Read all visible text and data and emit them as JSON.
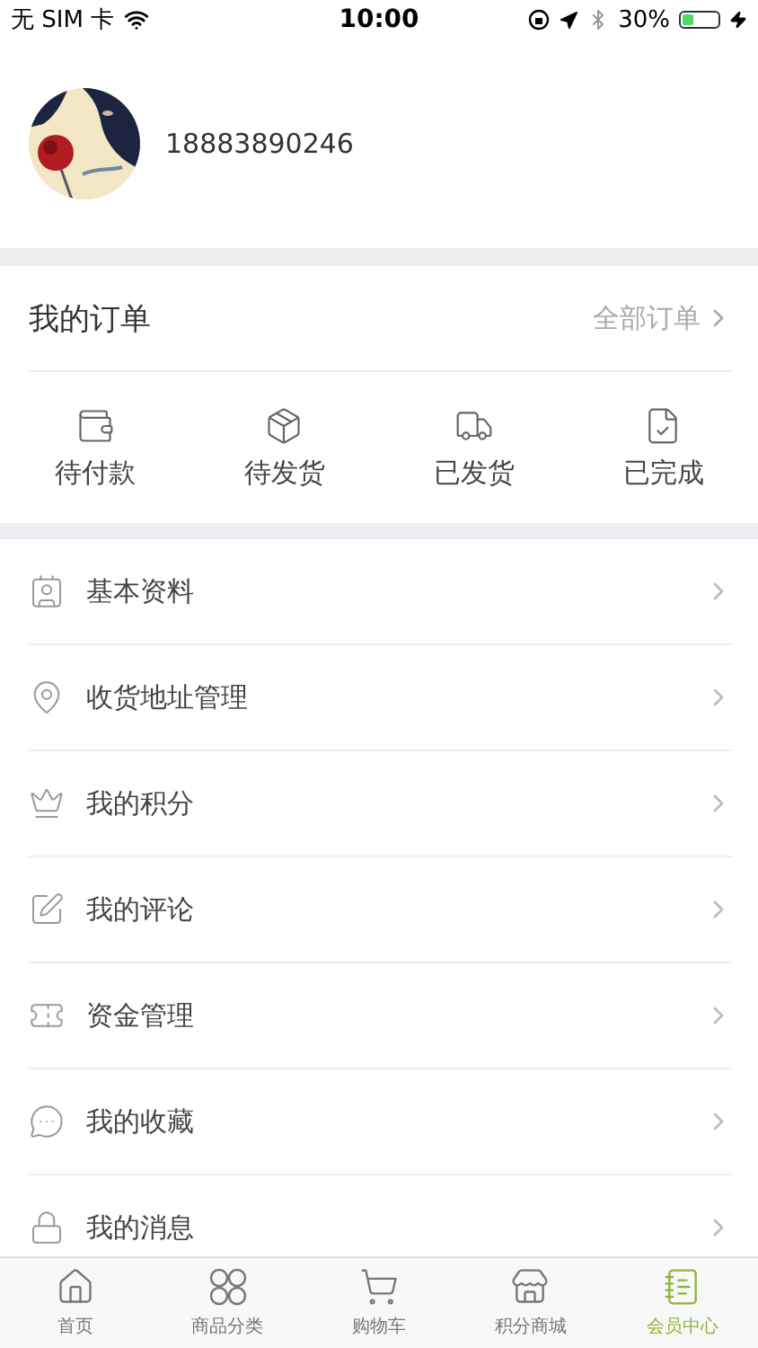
{
  "status_bar": {
    "carrier": "无 SIM 卡",
    "time": "10:00",
    "battery": "30%"
  },
  "profile": {
    "phone": "18883890246"
  },
  "orders": {
    "title": "我的订单",
    "all_link": "全部订单",
    "items": [
      {
        "kind": "wallet",
        "label": "待付款"
      },
      {
        "kind": "box",
        "label": "待发货"
      },
      {
        "kind": "truck",
        "label": "已发货"
      },
      {
        "kind": "done",
        "label": "已完成"
      }
    ]
  },
  "menu": [
    {
      "kind": "profile",
      "label": "基本资料"
    },
    {
      "kind": "address",
      "label": "收货地址管理"
    },
    {
      "kind": "points",
      "label": "我的积分"
    },
    {
      "kind": "review",
      "label": "我的评论"
    },
    {
      "kind": "funds",
      "label": "资金管理"
    },
    {
      "kind": "favorites",
      "label": "我的收藏"
    },
    {
      "kind": "messages",
      "label": "我的消息"
    }
  ],
  "tab_bar": [
    {
      "kind": "home",
      "label": "首页",
      "selected": false
    },
    {
      "kind": "category",
      "label": "商品分类",
      "selected": false
    },
    {
      "kind": "cart",
      "label": "购物车",
      "selected": false
    },
    {
      "kind": "mall",
      "label": "积分商城",
      "selected": false
    },
    {
      "kind": "member",
      "label": "会员中心",
      "selected": true
    }
  ]
}
